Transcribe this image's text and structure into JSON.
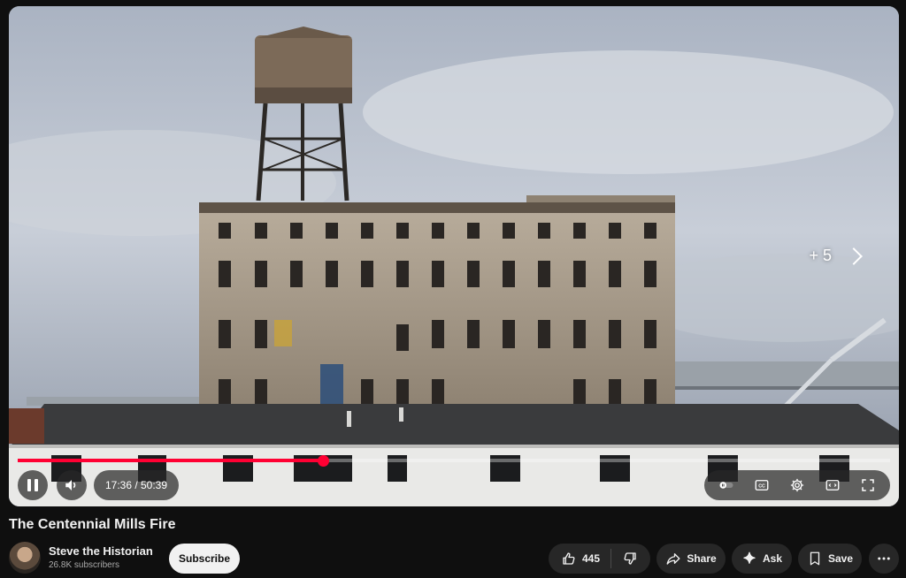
{
  "video": {
    "overlay_more_label": "+ 5",
    "time_display": "17:36 / 50:39",
    "progress_fraction": 0.35,
    "title": "The Centennial Mills Fire"
  },
  "channel": {
    "name": "Steve the Historian",
    "subscribers": "26.8K subscribers",
    "subscribe_label": "Subscribe"
  },
  "actions": {
    "like_count": "445",
    "share_label": "Share",
    "ask_label": "Ask",
    "save_label": "Save"
  },
  "colors": {
    "progress": "#ff0033",
    "background": "#0f0f0f",
    "pill": "#272727"
  }
}
